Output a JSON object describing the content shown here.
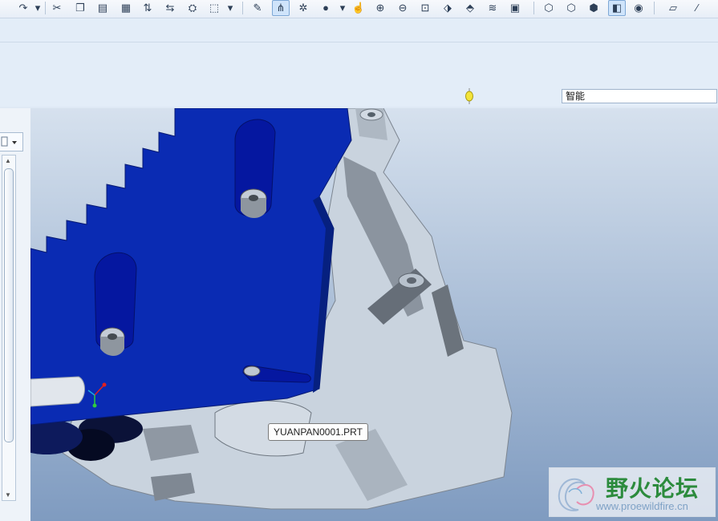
{
  "toolbar": {
    "icons": [
      "redo-icon",
      "cut-icon",
      "copy-icon",
      "paste-icon",
      "paste-special-icon",
      "regenerate-icon",
      "regenerate-manager-icon",
      "find-icon",
      "select-box-icon",
      "sketch-icon",
      "datum-icon",
      "spin-center-icon",
      "shading-icon",
      "pan-icon",
      "zoom-in-icon",
      "zoom-out-icon",
      "refit-icon",
      "reorient-icon",
      "saved-views-icon",
      "layers-icon",
      "appearance-icon",
      "wireframe-icon",
      "hidden-line-icon",
      "no-hidden-icon",
      "shaded-icon",
      "spotlight-icon",
      "datum-plane-icon",
      "datum-axis-icon"
    ]
  },
  "filter": {
    "value": "智能"
  },
  "viewport": {
    "tooltip": "YUANPAN0001.PRT"
  },
  "watermark": {
    "title": "野火论坛",
    "url": "www.proewildfire.cn"
  },
  "colors": {
    "part_blue": "#0a2bb3",
    "part_gray": "#c9d3de",
    "toolbar_bg": "#e3edf8"
  }
}
